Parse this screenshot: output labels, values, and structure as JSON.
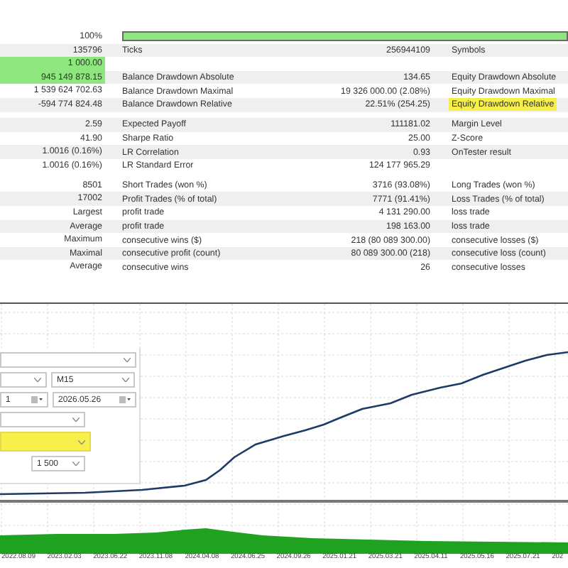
{
  "progress": {
    "percent": "100%",
    "level": 1
  },
  "report": [
    {
      "kind": "row",
      "cells": [
        {
          "text": "135796"
        },
        {
          "text": "Ticks"
        },
        {
          "text": "256944109"
        },
        {
          "text": "Symbols"
        }
      ]
    },
    {
      "kind": "row",
      "cells": [
        {
          "text": "1 000.00",
          "color": "#8ee67e"
        },
        {},
        {},
        {}
      ]
    },
    {
      "kind": "row",
      "cells": [
        {
          "text": "945 149 878.15",
          "color": "#8ee67e"
        },
        {
          "text": "Balance Drawdown Absolute"
        },
        {
          "text": "134.65"
        },
        {
          "text": "Equity Drawdown Absolute"
        }
      ]
    },
    {
      "kind": "row",
      "cells": [
        {
          "text": "1 539 624 702.63"
        },
        {
          "text": "Balance Drawdown Maximal"
        },
        {
          "text": "19 326 000.00 (2.08%)"
        },
        {
          "text": "Equity Drawdown Maximal"
        }
      ]
    },
    {
      "kind": "row",
      "cells": [
        {
          "text": "-594 774 824.48"
        },
        {
          "text": "Balance Drawdown Relative"
        },
        {
          "text": "22.51% (254.25)"
        },
        {
          "text": "Equity Drawdown Relative",
          "color": "#f6ef4a"
        }
      ]
    },
    {
      "kind": "spacer"
    },
    {
      "kind": "row",
      "cells": [
        {
          "text": "2.59"
        },
        {
          "text": "Expected Payoff"
        },
        {
          "text": "111181.02"
        },
        {
          "text": "Margin Level"
        }
      ]
    },
    {
      "kind": "row",
      "cells": [
        {
          "text": "41.90"
        },
        {
          "text": "Sharpe Ratio"
        },
        {
          "text": "25.00"
        },
        {
          "text": "Z-Score"
        }
      ]
    },
    {
      "kind": "row",
      "cells": [
        {
          "text": "1.0016 (0.16%)"
        },
        {
          "text": "LR Correlation"
        },
        {
          "text": "0.93"
        },
        {
          "text": "OnTester result"
        }
      ]
    },
    {
      "kind": "row",
      "cells": [
        {
          "text": "1.0016 (0.16%)"
        },
        {
          "text": "LR Standard Error"
        },
        {
          "text": "124 177 965.29"
        },
        {}
      ]
    },
    {
      "kind": "spacer"
    },
    {
      "kind": "row",
      "cells": [
        {
          "text": "8501"
        },
        {
          "text": "Short Trades (won %)"
        },
        {
          "text": "3716 (93.08%)"
        },
        {
          "text": "Long Trades (won %)"
        }
      ]
    },
    {
      "kind": "row",
      "cells": [
        {
          "text": "17002"
        },
        {
          "text": "Profit Trades (% of total)"
        },
        {
          "text": "7771 (91.41%)"
        },
        {
          "text": "Loss Trades (% of total)"
        }
      ]
    },
    {
      "kind": "row",
      "cells": [
        {
          "text": "Largest"
        },
        {
          "text": "profit trade"
        },
        {
          "text": "4 131 290.00"
        },
        {
          "text": "loss trade"
        }
      ]
    },
    {
      "kind": "row",
      "cells": [
        {
          "text": "Average"
        },
        {
          "text": "profit trade"
        },
        {
          "text": "198 163.00"
        },
        {
          "text": "loss trade"
        }
      ]
    },
    {
      "kind": "row",
      "cells": [
        {
          "text": "Maximum"
        },
        {
          "text": "consecutive wins ($)"
        },
        {
          "text": "218 (80 089 300.00)"
        },
        {
          "text": "consecutive losses ($)"
        }
      ]
    },
    {
      "kind": "row",
      "cells": [
        {
          "text": "Maximal"
        },
        {
          "text": "consecutive profit (count)"
        },
        {
          "text": "80 089 300.00 (218)"
        },
        {
          "text": "consecutive loss (count)"
        }
      ]
    },
    {
      "kind": "row",
      "cells": [
        {
          "text": "Average"
        },
        {
          "text": "consecutive wins"
        },
        {
          "text": "26"
        },
        {
          "text": "consecutive losses"
        }
      ]
    }
  ],
  "settings": [
    [
      {
        "kind": "dropdown",
        "highlighted": false
      }
    ],
    [
      {
        "kind": "dropdown",
        "highlighted": false
      },
      {
        "kind": "dropdown",
        "value": "M15",
        "highlighted": false
      }
    ],
    [
      {
        "kind": "date",
        "value": "1",
        "highlighted": false
      },
      {
        "kind": "date",
        "value": "2026.05.26",
        "highlighted": false
      }
    ],
    [
      {
        "kind": "dropdown",
        "highlighted": false
      }
    ],
    [
      {
        "kind": "dropdown",
        "highlighted": true
      }
    ],
    [
      {
        "kind": "dropdown",
        "value": "1 500",
        "highlighted": false
      }
    ]
  ],
  "chart": {
    "dates": [
      "2022.08.09",
      "2023.02.03",
      "2023.06.22",
      "2023.11.08",
      "2024.04.08",
      "2024.06.25",
      "2024.09.26",
      "2025.01.21",
      "2025.03.21",
      "2025.04.11",
      "2025.05.16",
      "2025.07.21",
      "202"
    ]
  }
}
